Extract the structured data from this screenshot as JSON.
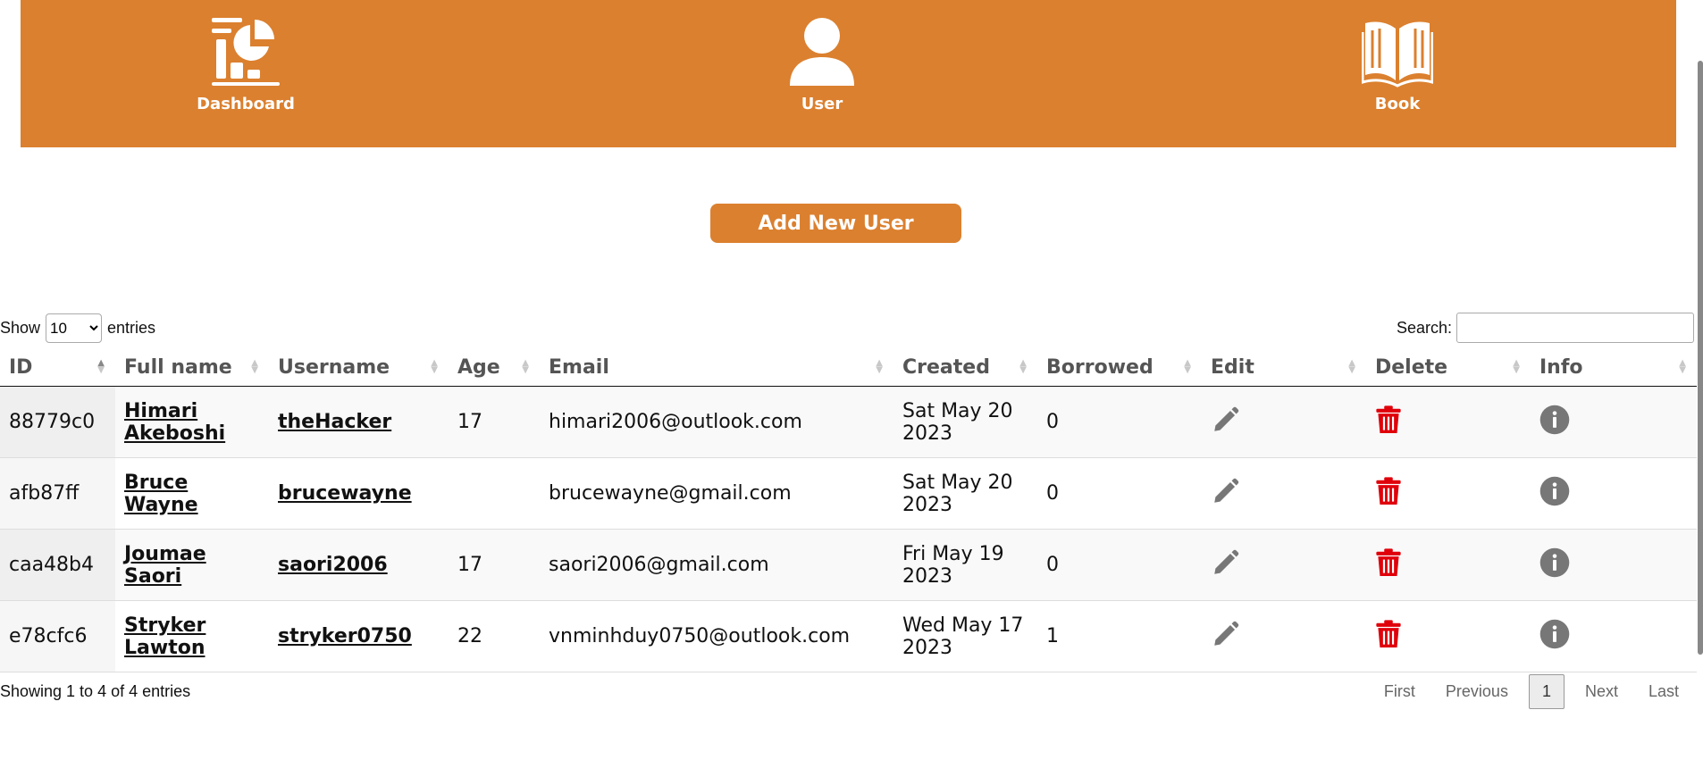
{
  "nav": [
    {
      "label": "Dashboard",
      "icon": "dashboard-icon"
    },
    {
      "label": "User",
      "icon": "user-icon"
    },
    {
      "label": "Book",
      "icon": "book-icon"
    }
  ],
  "add_button": "Add New User",
  "length_control": {
    "prefix": "Show",
    "value": "10",
    "suffix": "entries"
  },
  "search": {
    "label": "Search:",
    "value": ""
  },
  "table": {
    "columns": [
      "ID",
      "Full name",
      "Username",
      "Age",
      "Email",
      "Created",
      "Borrowed",
      "Edit",
      "Delete",
      "Info"
    ],
    "rows": [
      {
        "id": "88779c0",
        "first": "Himari",
        "last": "Akeboshi",
        "username": "theHacker",
        "age": "17",
        "email": "himari2006@outlook.com",
        "created1": "Sat May 20",
        "created2": "2023",
        "borrowed": "0"
      },
      {
        "id": "afb87ff",
        "first": "Bruce",
        "last": "Wayne",
        "username": "brucewayne",
        "age": "",
        "email": "brucewayne@gmail.com",
        "created1": "Sat May 20",
        "created2": "2023",
        "borrowed": "0"
      },
      {
        "id": "caa48b4",
        "first": "Joumae",
        "last": "Saori",
        "username": "saori2006",
        "age": "17",
        "email": "saori2006@gmail.com",
        "created1": "Fri May 19",
        "created2": "2023",
        "borrowed": "0"
      },
      {
        "id": "e78cfc6",
        "first": "Stryker",
        "last": "Lawton",
        "username": "stryker0750",
        "age": "22",
        "email": "vnminhduy0750@outlook.com",
        "created1": "Wed May 17",
        "created2": "2023",
        "borrowed": "1"
      }
    ]
  },
  "info_text": "Showing 1 to 4 of 4 entries",
  "pager": {
    "first": "First",
    "previous": "Previous",
    "current": "1",
    "next": "Next",
    "last": "Last"
  },
  "colors": {
    "accent": "#db802f",
    "delete": "#e0000a",
    "icon_gray": "#777777"
  }
}
